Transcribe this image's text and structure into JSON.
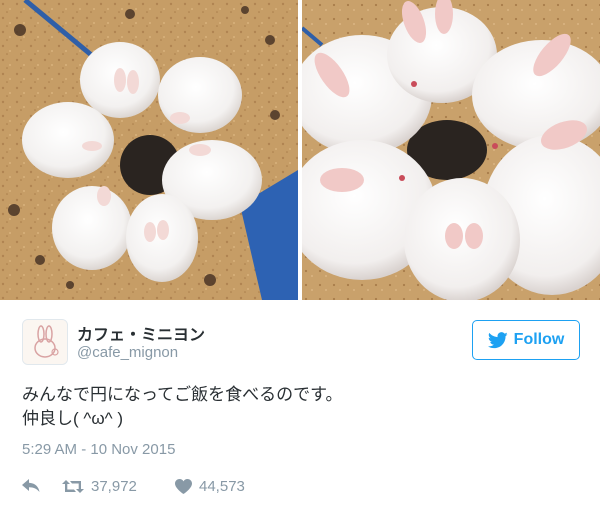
{
  "tweet": {
    "author": {
      "display_name": "カフェ・ミニヨン",
      "handle": "@cafe_mignon",
      "avatar_icon": "rabbit-logo-icon"
    },
    "follow_label": "Follow",
    "text_lines": [
      "みんなで円になってご飯を食べるのです。",
      "仲良し( ^ω^ )"
    ],
    "timestamp": "5:29 AM - 10 Nov 2015",
    "actions": {
      "reply_icon": "reply-arrow-icon",
      "retweet_icon": "retweet-icon",
      "retweet_count": "37,972",
      "like_icon": "heart-icon",
      "like_count": "44,573"
    },
    "media": {
      "photo_count": 2
    }
  },
  "colors": {
    "accent": "#1da1f2",
    "text": "#292f33",
    "muted": "#8899a6"
  }
}
